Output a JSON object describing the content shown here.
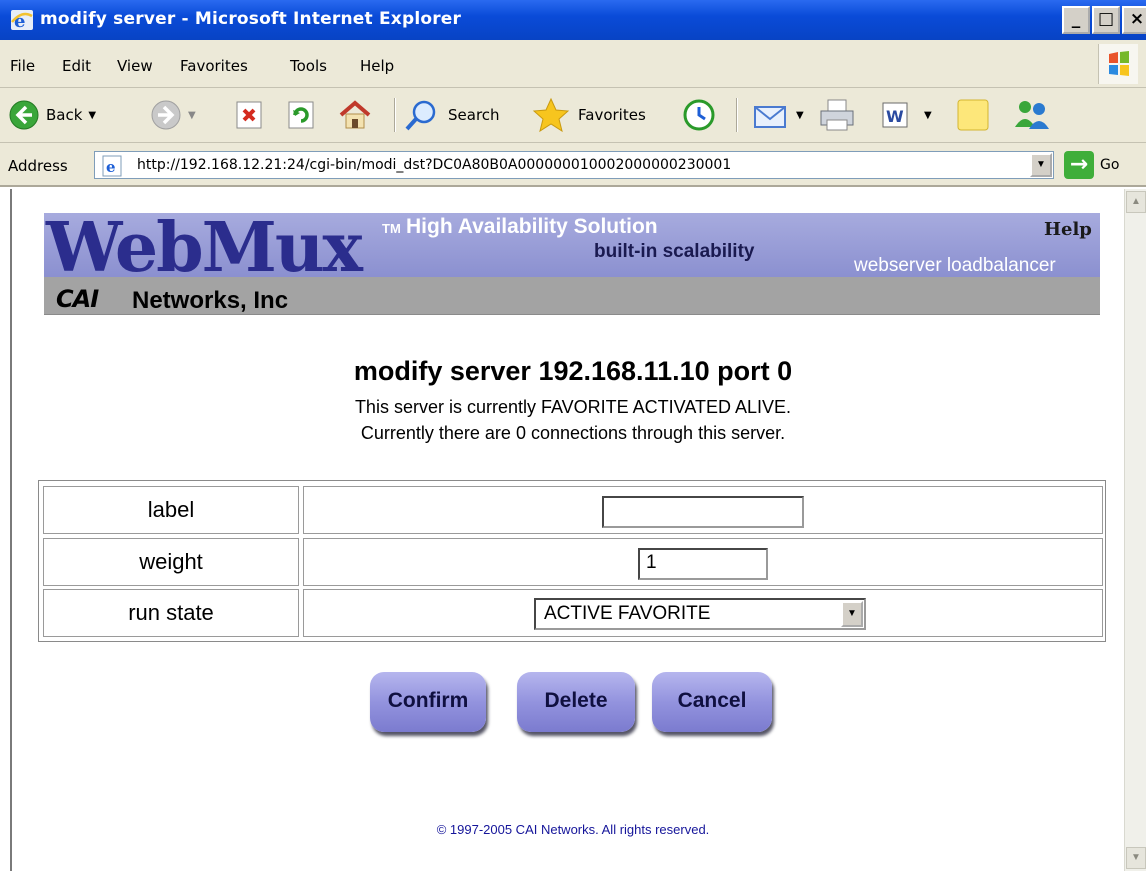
{
  "window": {
    "title": "modify server - Microsoft Internet Explorer",
    "min_glyph": "_",
    "max_glyph": "□",
    "close_glyph": "×"
  },
  "menu": [
    "File",
    "Edit",
    "View",
    "Favorites",
    "Tools",
    "Help"
  ],
  "toolbar": {
    "back_label": "Back",
    "search_label": "Search",
    "favorites_label": "Favorites"
  },
  "address": {
    "label": "Address",
    "url": "http://192.168.12.21:24/cgi-bin/modi_dst?DC0A80B0A000000010002000000230001",
    "go_label": "Go"
  },
  "banner": {
    "logo": "WebMux",
    "tm": "TM",
    "tagline1": "High Availability Solution",
    "tagline2": "built-in scalability",
    "tagline3": "webserver loadbalancer",
    "help": "Help",
    "cai_logo": "CAI",
    "company": "Networks, Inc"
  },
  "page": {
    "title": "modify server 192.168.11.10 port 0",
    "status_line1": "This server is currently FAVORITE ACTIVATED ALIVE.",
    "status_line2": "Currently there are 0 connections through this server."
  },
  "form": {
    "label_field": {
      "label": "label",
      "value": ""
    },
    "weight_field": {
      "label": "weight",
      "value": "1"
    },
    "run_state_field": {
      "label": "run state",
      "selected": "ACTIVE FAVORITE"
    }
  },
  "buttons": {
    "confirm": "Confirm",
    "delete": "Delete",
    "cancel": "Cancel"
  },
  "footer": {
    "copyright": "© 1997-2005 CAI Networks. All rights reserved."
  },
  "colors": {
    "titlebar": "#0a4bd8",
    "banner_top": "#a7abde",
    "banner_bottom": "#a3a3a3",
    "button": "#9393de",
    "copyright": "#15159a"
  }
}
